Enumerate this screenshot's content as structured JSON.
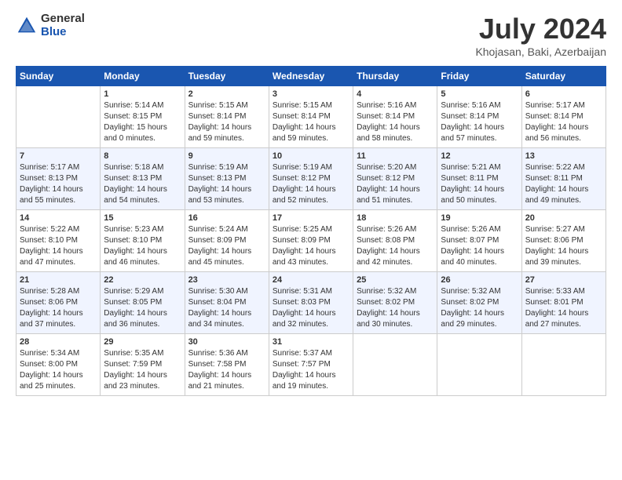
{
  "logo": {
    "general": "General",
    "blue": "Blue"
  },
  "title": "July 2024",
  "subtitle": "Khojasan, Baki, Azerbaijan",
  "weekdays": [
    "Sunday",
    "Monday",
    "Tuesday",
    "Wednesday",
    "Thursday",
    "Friday",
    "Saturday"
  ],
  "weeks": [
    [
      {
        "day": "",
        "info": ""
      },
      {
        "day": "1",
        "info": "Sunrise: 5:14 AM\nSunset: 8:15 PM\nDaylight: 15 hours\nand 0 minutes."
      },
      {
        "day": "2",
        "info": "Sunrise: 5:15 AM\nSunset: 8:14 PM\nDaylight: 14 hours\nand 59 minutes."
      },
      {
        "day": "3",
        "info": "Sunrise: 5:15 AM\nSunset: 8:14 PM\nDaylight: 14 hours\nand 59 minutes."
      },
      {
        "day": "4",
        "info": "Sunrise: 5:16 AM\nSunset: 8:14 PM\nDaylight: 14 hours\nand 58 minutes."
      },
      {
        "day": "5",
        "info": "Sunrise: 5:16 AM\nSunset: 8:14 PM\nDaylight: 14 hours\nand 57 minutes."
      },
      {
        "day": "6",
        "info": "Sunrise: 5:17 AM\nSunset: 8:14 PM\nDaylight: 14 hours\nand 56 minutes."
      }
    ],
    [
      {
        "day": "7",
        "info": "Sunrise: 5:17 AM\nSunset: 8:13 PM\nDaylight: 14 hours\nand 55 minutes."
      },
      {
        "day": "8",
        "info": "Sunrise: 5:18 AM\nSunset: 8:13 PM\nDaylight: 14 hours\nand 54 minutes."
      },
      {
        "day": "9",
        "info": "Sunrise: 5:19 AM\nSunset: 8:13 PM\nDaylight: 14 hours\nand 53 minutes."
      },
      {
        "day": "10",
        "info": "Sunrise: 5:19 AM\nSunset: 8:12 PM\nDaylight: 14 hours\nand 52 minutes."
      },
      {
        "day": "11",
        "info": "Sunrise: 5:20 AM\nSunset: 8:12 PM\nDaylight: 14 hours\nand 51 minutes."
      },
      {
        "day": "12",
        "info": "Sunrise: 5:21 AM\nSunset: 8:11 PM\nDaylight: 14 hours\nand 50 minutes."
      },
      {
        "day": "13",
        "info": "Sunrise: 5:22 AM\nSunset: 8:11 PM\nDaylight: 14 hours\nand 49 minutes."
      }
    ],
    [
      {
        "day": "14",
        "info": "Sunrise: 5:22 AM\nSunset: 8:10 PM\nDaylight: 14 hours\nand 47 minutes."
      },
      {
        "day": "15",
        "info": "Sunrise: 5:23 AM\nSunset: 8:10 PM\nDaylight: 14 hours\nand 46 minutes."
      },
      {
        "day": "16",
        "info": "Sunrise: 5:24 AM\nSunset: 8:09 PM\nDaylight: 14 hours\nand 45 minutes."
      },
      {
        "day": "17",
        "info": "Sunrise: 5:25 AM\nSunset: 8:09 PM\nDaylight: 14 hours\nand 43 minutes."
      },
      {
        "day": "18",
        "info": "Sunrise: 5:26 AM\nSunset: 8:08 PM\nDaylight: 14 hours\nand 42 minutes."
      },
      {
        "day": "19",
        "info": "Sunrise: 5:26 AM\nSunset: 8:07 PM\nDaylight: 14 hours\nand 40 minutes."
      },
      {
        "day": "20",
        "info": "Sunrise: 5:27 AM\nSunset: 8:06 PM\nDaylight: 14 hours\nand 39 minutes."
      }
    ],
    [
      {
        "day": "21",
        "info": "Sunrise: 5:28 AM\nSunset: 8:06 PM\nDaylight: 14 hours\nand 37 minutes."
      },
      {
        "day": "22",
        "info": "Sunrise: 5:29 AM\nSunset: 8:05 PM\nDaylight: 14 hours\nand 36 minutes."
      },
      {
        "day": "23",
        "info": "Sunrise: 5:30 AM\nSunset: 8:04 PM\nDaylight: 14 hours\nand 34 minutes."
      },
      {
        "day": "24",
        "info": "Sunrise: 5:31 AM\nSunset: 8:03 PM\nDaylight: 14 hours\nand 32 minutes."
      },
      {
        "day": "25",
        "info": "Sunrise: 5:32 AM\nSunset: 8:02 PM\nDaylight: 14 hours\nand 30 minutes."
      },
      {
        "day": "26",
        "info": "Sunrise: 5:32 AM\nSunset: 8:02 PM\nDaylight: 14 hours\nand 29 minutes."
      },
      {
        "day": "27",
        "info": "Sunrise: 5:33 AM\nSunset: 8:01 PM\nDaylight: 14 hours\nand 27 minutes."
      }
    ],
    [
      {
        "day": "28",
        "info": "Sunrise: 5:34 AM\nSunset: 8:00 PM\nDaylight: 14 hours\nand 25 minutes."
      },
      {
        "day": "29",
        "info": "Sunrise: 5:35 AM\nSunset: 7:59 PM\nDaylight: 14 hours\nand 23 minutes."
      },
      {
        "day": "30",
        "info": "Sunrise: 5:36 AM\nSunset: 7:58 PM\nDaylight: 14 hours\nand 21 minutes."
      },
      {
        "day": "31",
        "info": "Sunrise: 5:37 AM\nSunset: 7:57 PM\nDaylight: 14 hours\nand 19 minutes."
      },
      {
        "day": "",
        "info": ""
      },
      {
        "day": "",
        "info": ""
      },
      {
        "day": "",
        "info": ""
      }
    ]
  ]
}
